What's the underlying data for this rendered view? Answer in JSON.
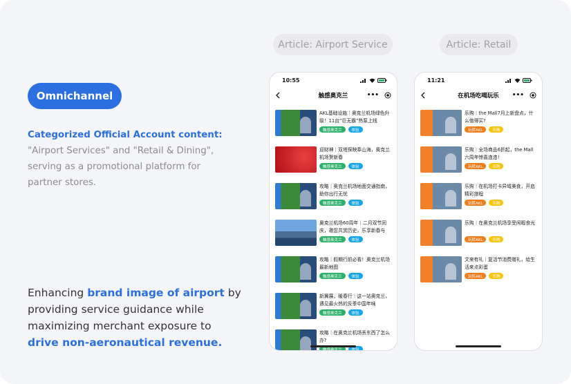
{
  "left": {
    "pill_label": "Omnichannel",
    "desc1_highlight": "Categorized Official Account content:",
    "desc1_rest": " \"Airport Services\" and \"Retail & Dining\", serving as a promotional platform for partner stores.",
    "desc2_part1": "Enhancing ",
    "desc2_highlight1": "brand image of airport",
    "desc2_part2": " by providing service guidance while maximizing merchant exposure to ",
    "desc2_highlight2": "drive non-aeronautical revenue."
  },
  "tags": {
    "airport": "Article: Airport Service",
    "retail": "Article: Retail"
  },
  "colors": {
    "accent": "#2c6fe0",
    "badge_green": "#2fb06a",
    "badge_blue": "#19a6e6",
    "badge_orange": "#f07d1a",
    "badge_yellow": "#f5c40f"
  },
  "phone1": {
    "time": "10:55",
    "title": "触感奥克兰",
    "items": [
      {
        "title": "AKL基础设施｜奥克兰机场绿色升级！11台“巨无霸”热泵上线",
        "badges": [
          "触感奥克兰",
          "体验"
        ],
        "thumb": "air"
      },
      {
        "title": "迎财神｜双塔探映奉山海，奥克兰机场贺新春",
        "badges": [
          "触感奥克兰",
          "体验"
        ],
        "thumb": "red"
      },
      {
        "title": "攻略｜奥克兰机场地面交通指南，助你出行无忧",
        "badges": [
          "触感奥克兰",
          "体验"
        ],
        "thumb": "air"
      },
      {
        "title": "奥克兰机场60周年｜二月双节同庆，邀您共赏历史，乐享新春与",
        "badges": [
          "触感奥克兰",
          "体验"
        ],
        "thumb": "city"
      },
      {
        "title": "攻略｜假期行前必看！奥克兰机场最新地图",
        "badges": [
          "触感奥克兰",
          "体验"
        ],
        "thumb": "air"
      },
      {
        "title": "新冀展，暖春行｜这一站奥克兰，遇见最火热的反季中国年味",
        "badges": [
          "触感奥克兰",
          "体验"
        ],
        "thumb": "air"
      },
      {
        "title": "攻略｜在奥克兰机场丢东西了怎么办?",
        "badges": [
          "触感奥克兰",
          "体验"
        ],
        "thumb": "air"
      }
    ]
  },
  "phone2": {
    "time": "11:21",
    "title": "在机场吃喝玩乐",
    "items": [
      {
        "title": "乐购｜the Mall7月上新盘点，什么值得买?",
        "badges": [
          "玩转AKL",
          "乐购"
        ]
      },
      {
        "title": "乐购｜全场商品6折起，the Mall六周年惊喜连连！",
        "badges": [
          "玩转AKL",
          "乐购"
        ]
      },
      {
        "title": "乐购｜在机场打卡异域美食，开启精彩旅程",
        "badges": [
          "玩转AKL",
          "乐购"
        ]
      },
      {
        "title": "乐购｜在奥克兰机场享受闲暇食光",
        "badges": [
          "玩转AKL",
          "乐购"
        ]
      },
      {
        "title": "文来有礼｜复活节消费赠礼，给生活来点彩蛋",
        "badges": [
          "玩转AKL",
          "乐购"
        ]
      }
    ]
  }
}
